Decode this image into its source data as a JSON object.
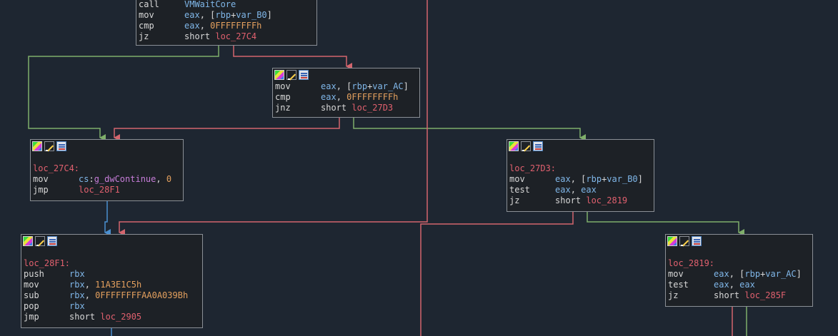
{
  "blocks": {
    "top": {
      "lines": [
        {
          "mn": "call",
          "ops": [
            {
              "t": "VMWaitCore",
              "c": "reg"
            }
          ]
        },
        {
          "mn": "mov",
          "ops": [
            {
              "t": "eax",
              "c": "reg"
            },
            {
              "t": ", [",
              "c": "kw"
            },
            {
              "t": "rbp",
              "c": "reg"
            },
            {
              "t": "+",
              "c": "kw"
            },
            {
              "t": "var_B0",
              "c": "var"
            },
            {
              "t": "]",
              "c": "kw"
            }
          ]
        },
        {
          "mn": "cmp",
          "ops": [
            {
              "t": "eax",
              "c": "reg"
            },
            {
              "t": ", ",
              "c": "kw"
            },
            {
              "t": "0FFFFFFFFh",
              "c": "num"
            }
          ]
        },
        {
          "mn": "jz",
          "ops": [
            {
              "t": "short ",
              "c": "kw"
            },
            {
              "t": "loc_27C4",
              "c": "loc"
            }
          ]
        }
      ]
    },
    "b2": {
      "lines": [
        {
          "mn": "mov",
          "ops": [
            {
              "t": "eax",
              "c": "reg"
            },
            {
              "t": ", [",
              "c": "kw"
            },
            {
              "t": "rbp",
              "c": "reg"
            },
            {
              "t": "+",
              "c": "kw"
            },
            {
              "t": "var_AC",
              "c": "var"
            },
            {
              "t": "]",
              "c": "kw"
            }
          ]
        },
        {
          "mn": "cmp",
          "ops": [
            {
              "t": "eax",
              "c": "reg"
            },
            {
              "t": ", ",
              "c": "kw"
            },
            {
              "t": "0FFFFFFFFh",
              "c": "num"
            }
          ]
        },
        {
          "mn": "jnz",
          "ops": [
            {
              "t": "short ",
              "c": "kw"
            },
            {
              "t": "loc_27D3",
              "c": "loc"
            }
          ]
        }
      ]
    },
    "b27c4": {
      "label": "loc_27C4:",
      "lines": [
        {
          "mn": "mov",
          "ops": [
            {
              "t": "cs",
              "c": "reg"
            },
            {
              "t": ":",
              "c": "kw"
            },
            {
              "t": "g_dwContinue",
              "c": "sym"
            },
            {
              "t": ", ",
              "c": "kw"
            },
            {
              "t": "0",
              "c": "num"
            }
          ]
        },
        {
          "mn": "jmp",
          "ops": [
            {
              "t": "loc_28F1",
              "c": "loc"
            }
          ]
        }
      ]
    },
    "b27d3": {
      "label": "loc_27D3:",
      "lines": [
        {
          "mn": "mov",
          "ops": [
            {
              "t": "eax",
              "c": "reg"
            },
            {
              "t": ", [",
              "c": "kw"
            },
            {
              "t": "rbp",
              "c": "reg"
            },
            {
              "t": "+",
              "c": "kw"
            },
            {
              "t": "var_B0",
              "c": "var"
            },
            {
              "t": "]",
              "c": "kw"
            }
          ]
        },
        {
          "mn": "test",
          "ops": [
            {
              "t": "eax",
              "c": "reg"
            },
            {
              "t": ", ",
              "c": "kw"
            },
            {
              "t": "eax",
              "c": "reg"
            }
          ]
        },
        {
          "mn": "jz",
          "ops": [
            {
              "t": "short ",
              "c": "kw"
            },
            {
              "t": "loc_2819",
              "c": "loc"
            }
          ]
        }
      ]
    },
    "b28f1": {
      "label": "loc_28F1:",
      "lines": [
        {
          "mn": "push",
          "ops": [
            {
              "t": "rbx",
              "c": "reg"
            }
          ]
        },
        {
          "mn": "mov",
          "ops": [
            {
              "t": "rbx",
              "c": "reg"
            },
            {
              "t": ", ",
              "c": "kw"
            },
            {
              "t": "11A3E1C5h",
              "c": "num"
            }
          ]
        },
        {
          "mn": "sub",
          "ops": [
            {
              "t": "rbx",
              "c": "reg"
            },
            {
              "t": ", ",
              "c": "kw"
            },
            {
              "t": "0FFFFFFFFAA0A039Bh",
              "c": "num"
            }
          ]
        },
        {
          "mn": "pop",
          "ops": [
            {
              "t": "rbx",
              "c": "reg"
            }
          ]
        },
        {
          "mn": "jmp",
          "ops": [
            {
              "t": "short ",
              "c": "kw"
            },
            {
              "t": "loc_2905",
              "c": "loc"
            }
          ]
        }
      ]
    },
    "b2819": {
      "label": "loc_2819:",
      "lines": [
        {
          "mn": "mov",
          "ops": [
            {
              "t": "eax",
              "c": "reg"
            },
            {
              "t": ", [",
              "c": "kw"
            },
            {
              "t": "rbp",
              "c": "reg"
            },
            {
              "t": "+",
              "c": "kw"
            },
            {
              "t": "var_AC",
              "c": "var"
            },
            {
              "t": "]",
              "c": "kw"
            }
          ]
        },
        {
          "mn": "test",
          "ops": [
            {
              "t": "eax",
              "c": "reg"
            },
            {
              "t": ", ",
              "c": "kw"
            },
            {
              "t": "eax",
              "c": "reg"
            }
          ]
        },
        {
          "mn": "jz",
          "ops": [
            {
              "t": "short ",
              "c": "kw"
            },
            {
              "t": "loc_285F",
              "c": "loc"
            }
          ]
        }
      ]
    }
  },
  "colors": {
    "background": "#1e2631",
    "edge_true": "#7fae6a",
    "edge_false": "#d3656d",
    "edge_uncond": "#4a8fd0",
    "block_border": "#8a8f96"
  },
  "header_icons": [
    "graph-icon",
    "edit-icon",
    "list-icon"
  ]
}
